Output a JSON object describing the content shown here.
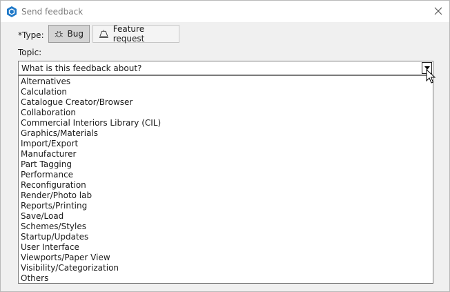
{
  "window": {
    "title": "Send feedback"
  },
  "type": {
    "label": "*Type:",
    "options": [
      {
        "label": "Bug",
        "icon": "bug-icon",
        "selected": true
      },
      {
        "label": "Feature request",
        "icon": "lamp-icon",
        "selected": false
      }
    ]
  },
  "topic": {
    "label": "Topic:",
    "placeholder": "What is this feedback about?",
    "options": [
      "Alternatives",
      "Calculation",
      "Catalogue Creator/Browser",
      "Collaboration",
      "Commercial Interiors Library (CIL)",
      "Graphics/Materials",
      "Import/Export",
      "Manufacturer",
      "Part Tagging",
      "Performance",
      "Reconfiguration",
      "Render/Photo lab",
      "Reports/Printing",
      "Save/Load",
      "Schemes/Styles",
      "Startup/Updates",
      "User Interface",
      "Viewports/Paper View",
      "Visibility/Categorization",
      "Others"
    ]
  },
  "colors": {
    "accent": "#1e78c8",
    "selected_button": "#d4d4d4",
    "dialog_background": "#f0f0f0"
  }
}
